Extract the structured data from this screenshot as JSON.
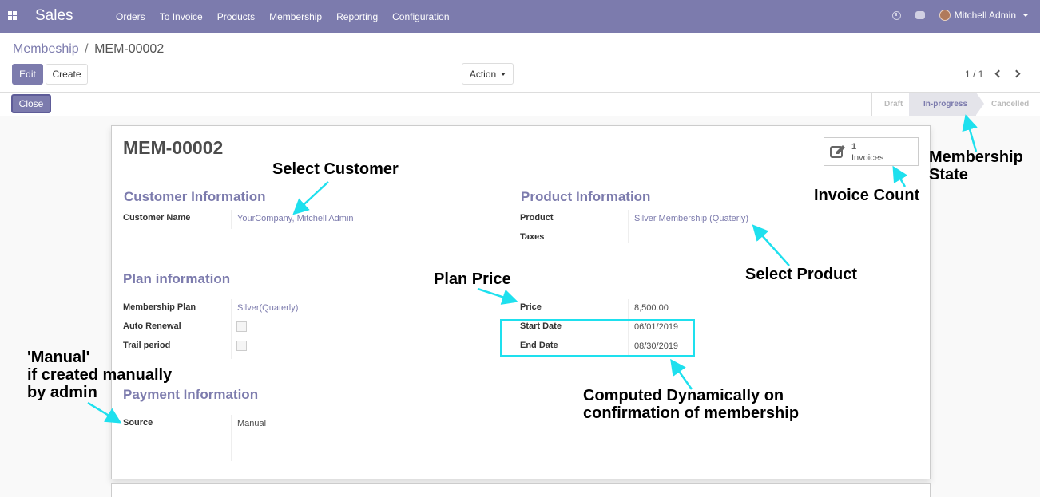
{
  "navbar": {
    "app_title": "Sales",
    "menu": [
      "Orders",
      "To Invoice",
      "Products",
      "Membership",
      "Reporting",
      "Configuration"
    ],
    "user_name": "Mitchell Admin",
    "icons": [
      "apps-grid-icon",
      "clock-icon",
      "chat-icon",
      "avatar"
    ]
  },
  "breadcrumb": {
    "parent": "Membeship",
    "separator": "/",
    "current": "MEM-00002"
  },
  "toolbar": {
    "edit_label": "Edit",
    "create_label": "Create",
    "action_label": "Action",
    "pager": "1 / 1"
  },
  "statusbar": {
    "close_label": "Close",
    "stages": [
      "Draft",
      "In-progress",
      "Cancelled"
    ],
    "active_stage": "In-progress"
  },
  "form": {
    "title": "MEM-00002",
    "smart_button": {
      "count": "1",
      "label": "Invoices"
    },
    "customer": {
      "title": "Customer Information",
      "name_label": "Customer Name",
      "name_value": "YourCompany, Mitchell Admin"
    },
    "product": {
      "title": "Product Information",
      "product_label": "Product",
      "product_value": "Silver Membership (Quaterly)",
      "taxes_label": "Taxes"
    },
    "plan": {
      "title": "Plan information",
      "plan_label": "Membership Plan",
      "plan_value": "Silver(Quaterly)",
      "auto_renewal_label": "Auto Renewal",
      "trail_label": "Trail period",
      "price_label": "Price",
      "price_value": "8,500.00",
      "start_label": "Start Date",
      "start_value": "06/01/2019",
      "end_label": "End Date",
      "end_value": "08/30/2019"
    },
    "payment": {
      "title": "Payment Information",
      "source_label": "Source",
      "source_value": "Manual"
    }
  },
  "annotations": {
    "select_customer": "Select Customer",
    "invoice_count": "Invoice Count",
    "membership_state_1": "Membership",
    "membership_state_2": "State",
    "plan_price": "Plan Price",
    "select_product": "Select Product",
    "manual_1": "'Manual'",
    "manual_2": "if created manually",
    "manual_3": "by admin",
    "computed_1": "Computed Dynamically on",
    "computed_2": "confirmation of membership",
    "color": "#1ee0ee"
  }
}
